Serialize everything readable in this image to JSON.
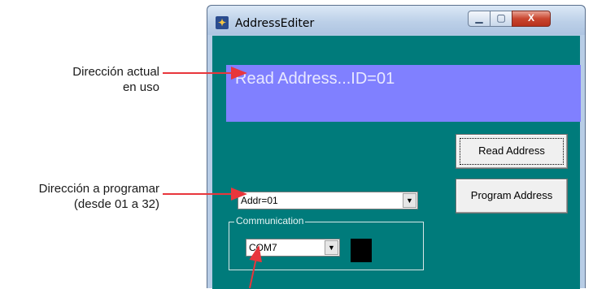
{
  "window": {
    "title": "AddressEditer",
    "controls": {
      "minimize_glyph": "▁",
      "maximize_glyph": "▢",
      "close_glyph": "X"
    }
  },
  "display": {
    "text": "Read Address...ID=01"
  },
  "buttons": {
    "read_address": "Read Address",
    "program_address": "Program Address"
  },
  "address_combo": {
    "value": "Addr=01",
    "arrow_glyph": "▼"
  },
  "communication": {
    "group_label": "Communication",
    "port_value": "COM7",
    "arrow_glyph": "▼"
  },
  "callouts": {
    "current_address": [
      "Dirección actual",
      "en uso"
    ],
    "program_address": [
      "Dirección a programar",
      "(desde 01 a 32)"
    ]
  },
  "colors": {
    "client_bg": "#007b7b",
    "display_bg": "#8080ff",
    "arrow": "#e8363c"
  }
}
